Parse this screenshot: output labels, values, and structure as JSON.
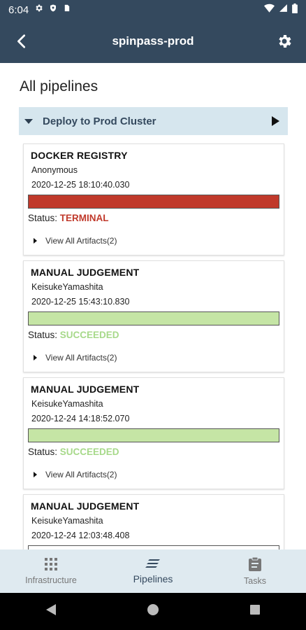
{
  "status_bar": {
    "time": "6:04"
  },
  "app_bar": {
    "title": "spinpass-prod"
  },
  "page": {
    "heading": "All pipelines"
  },
  "pipeline": {
    "name": "Deploy to Prod Cluster"
  },
  "executions": [
    {
      "stage": "DOCKER REGISTRY",
      "user": "Anonymous",
      "timestamp": "2020-12-25 18:10:40.030",
      "status_label": "Status:",
      "status": "TERMINAL",
      "status_color": "#c0392b",
      "bar_color": "#c0392b",
      "artifacts": "View All Artifacts(2)"
    },
    {
      "stage": "MANUAL JUDGEMENT",
      "user": "KeisukeYamashita",
      "timestamp": "2020-12-25 15:43:10.830",
      "status_label": "Status:",
      "status": "SUCCEEDED",
      "status_color": "#a7d98a",
      "bar_color": "#c5e5a5",
      "artifacts": "View All Artifacts(2)"
    },
    {
      "stage": "MANUAL JUDGEMENT",
      "user": "KeisukeYamashita",
      "timestamp": "2020-12-24 14:18:52.070",
      "status_label": "Status:",
      "status": "SUCCEEDED",
      "status_color": "#a7d98a",
      "bar_color": "#c5e5a5",
      "artifacts": "View All Artifacts(2)"
    },
    {
      "stage": "MANUAL JUDGEMENT",
      "user": "KeisukeYamashita",
      "timestamp": "2020-12-24 12:03:48.408"
    }
  ],
  "bottom_nav": {
    "infrastructure": "Infrastructure",
    "pipelines": "Pipelines",
    "tasks": "Tasks"
  },
  "colors": {
    "primary": "#34495e",
    "header_bg": "#d6e6ee",
    "bottom_nav_bg": "#dfeaf0"
  }
}
